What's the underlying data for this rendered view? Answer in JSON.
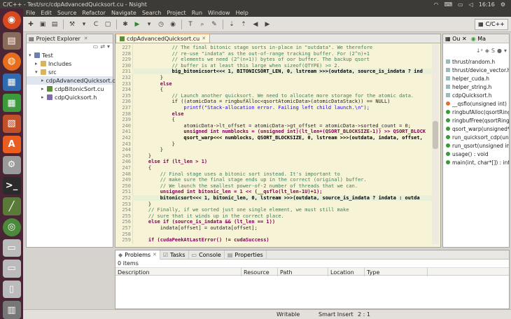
{
  "window": {
    "title": "C/C++ - Test/src/cdpAdvancedQuicksort.cu - Nsight",
    "clock": "16:16"
  },
  "menu": [
    "File",
    "Edit",
    "Source",
    "Refactor",
    "Navigate",
    "Search",
    "Project",
    "Run",
    "Window",
    "Help"
  ],
  "perspective": {
    "label": "C/C++"
  },
  "explorer": {
    "title": "Project Explorer",
    "tree": [
      {
        "label": "Test",
        "indent": 0,
        "arrow": "▾",
        "icon": "project"
      },
      {
        "label": "Includes",
        "indent": 1,
        "arrow": "▸",
        "icon": "folder"
      },
      {
        "label": "src",
        "indent": 1,
        "arrow": "▾",
        "icon": "folder"
      },
      {
        "label": "cdpAdvancedQuicksort.cu",
        "indent": 2,
        "arrow": "▸",
        "icon": "file-cu",
        "selected": true
      },
      {
        "label": "cdpBitonicSort.cu",
        "indent": 2,
        "arrow": "▸",
        "icon": "file-cu"
      },
      {
        "label": "cdpQuicksort.h",
        "indent": 2,
        "arrow": "▸",
        "icon": "file-h"
      }
    ]
  },
  "editor": {
    "tab_label": "cdpAdvancedQuicksort.cu",
    "lines": [
      {
        "n": "227",
        "t": "            // The final bitonic stage sorts in-place in \"outdata\". We therefore",
        "c": "cm"
      },
      {
        "n": "228",
        "t": "            // re-use \"indata\" as the out-of-range tracking buffer. For (2^n)+1",
        "c": "cm"
      },
      {
        "n": "229",
        "t": "            // elements we need (2^(n+1)) bytes of oor buffer. The backup qsort",
        "c": "cm"
      },
      {
        "n": "230",
        "t": "            // buffer is at least this large when sizeof(QTYPE) >= 2.",
        "c": "cm"
      },
      {
        "n": "231",
        "t": "            big_bitonicsort<<< 1, BITONICSORT_LEN, 0, lstream >>>(outdata, source_is_indata ? ind",
        "c": "fn",
        "hl": true
      },
      {
        "n": "232",
        "t": "        }",
        "c": ""
      },
      {
        "n": "233",
        "t": "        else",
        "c": "kw"
      },
      {
        "n": "234",
        "t": "        {",
        "c": ""
      },
      {
        "n": "235",
        "t": "            // Launch another quicksort. We need to allocate more storage for the atomic data.",
        "c": "cm"
      },
      {
        "n": "236",
        "t": "            if ((atomicData = ringbufAlloc<qsortAtomicData>(atomicDataStack)) == NULL)",
        "c": ""
      },
      {
        "n": "237",
        "t": "                printf(\"Stack-allocation error. Failing left child launch.\\n\");",
        "c": "st"
      },
      {
        "n": "238",
        "t": "            else",
        "c": "kw"
      },
      {
        "n": "239",
        "t": "            {",
        "c": ""
      },
      {
        "n": "240",
        "t": "                atomicData->lt_offset = atomicData->gt_offset = atomicData->sorted_count = 0;",
        "c": ""
      },
      {
        "n": "241",
        "t": "                unsigned int numblocks = (unsigned int)(lt_len+(QSORT_BLOCKSIZE-1)) >> QSORT_BLOCK",
        "c": "kw"
      },
      {
        "n": "242",
        "t": "                qsort_warp<<< numblocks, QSORT_BLOCKSIZE, 0, lstream >>>(outdata, indata, offset,",
        "c": "fn"
      },
      {
        "n": "243",
        "t": "            }",
        "c": ""
      },
      {
        "n": "244",
        "t": "        }",
        "c": ""
      },
      {
        "n": "245",
        "t": "    }",
        "c": ""
      },
      {
        "n": "246",
        "t": "    else if (lt_len > 1)",
        "c": "kw"
      },
      {
        "n": "247",
        "t": "    {",
        "c": ""
      },
      {
        "n": "248",
        "t": "        // Final stage uses a bitonic sort instead. It's important to",
        "c": "cm"
      },
      {
        "n": "249",
        "t": "        // make sure the final stage ends up in the correct (original) buffer.",
        "c": "cm"
      },
      {
        "n": "250",
        "t": "        // We launch the smallest power-of-2 number of threads that we can.",
        "c": "cm"
      },
      {
        "n": "251",
        "t": "        unsigned int bitonic_len = 1 << (__qsflo(lt_len-1U)+1);",
        "c": "kw"
      },
      {
        "n": "252",
        "t": "        bitonicsort<<< 1, bitonic_len, 0, lstream >>>(outdata, source_is_indata ? indata : outda",
        "c": "fn",
        "hl": true
      },
      {
        "n": "253",
        "t": "    }",
        "c": ""
      },
      {
        "n": "254",
        "t": "    // Finally, if we sorted just one single element, we must still make",
        "c": "cm"
      },
      {
        "n": "255",
        "t": "    // sure that it winds up in the correct place.",
        "c": "cm"
      },
      {
        "n": "256",
        "t": "    else if (source_is_indata && (lt_len == 1))",
        "c": "kw"
      },
      {
        "n": "257",
        "t": "        indata[offset] = outdata[offset];",
        "c": ""
      },
      {
        "n": "258",
        "t": "",
        "c": ""
      },
      {
        "n": "259",
        "t": "    if (cudaPeekAtLastError() != cudaSuccess)",
        "c": "kw"
      }
    ]
  },
  "outline": {
    "tab_outline": "Ou",
    "tab_make": "Ma",
    "items": [
      {
        "label": "thrust/random.h",
        "kind": "include"
      },
      {
        "label": "thrust/device_vector.h",
        "kind": "include"
      },
      {
        "label": "helper_cuda.h",
        "kind": "include"
      },
      {
        "label": "helper_string.h",
        "kind": "include"
      },
      {
        "label": "cdpQuicksort.h",
        "kind": "include"
      },
      {
        "label": "__qsflo(unsigned int) :",
        "kind": "func",
        "color": "#e07030"
      },
      {
        "label": "ringbufAlloc(qsortRing",
        "kind": "func",
        "color": "#3a9a3a"
      },
      {
        "label": "ringbufFree(qsortRingb",
        "kind": "func",
        "color": "#3a9a3a"
      },
      {
        "label": "qsort_warp(unsigned*,",
        "kind": "func",
        "color": "#3a9a3a"
      },
      {
        "label": "run_quicksort_cdp(uns",
        "kind": "func",
        "color": "#3a9a3a"
      },
      {
        "label": "run_qsort(unsigned int",
        "kind": "func",
        "color": "#3a9a3a"
      },
      {
        "label": "usage() : void",
        "kind": "func",
        "color": "#3a9a3a"
      },
      {
        "label": "main(int, char*[]) : int",
        "kind": "func",
        "color": "#3a9a3a"
      }
    ]
  },
  "problems": {
    "tabs": [
      {
        "label": "Problems",
        "active": true
      },
      {
        "label": "Tasks",
        "active": false
      },
      {
        "label": "Console",
        "active": false
      },
      {
        "label": "Properties",
        "active": false
      }
    ],
    "count": "0 items",
    "columns": [
      "Description",
      "Resource",
      "Path",
      "Location",
      "Type"
    ]
  },
  "status": {
    "writable": "Writable",
    "insert_mode": "Smart Insert",
    "position": "2 : 1"
  },
  "colors": {
    "launcher_bg": "#4a2535",
    "editor_bg": "#f6f3d6",
    "comment": "#3f7f5f",
    "keyword": "#7f0055"
  }
}
